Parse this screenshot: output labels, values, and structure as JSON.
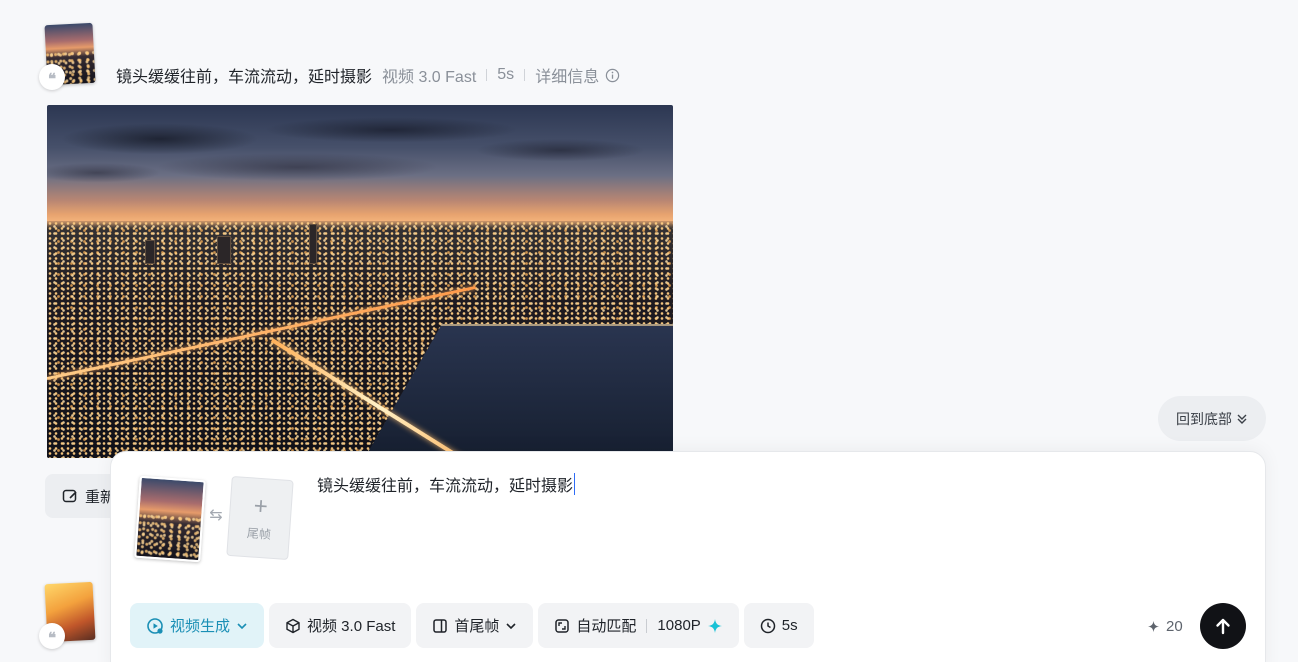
{
  "history": {
    "prompt": "镜头缓缓往前，车流流动，延时摄影",
    "model": "视频 3.0 Fast",
    "duration": "5s",
    "details_label": "详细信息",
    "quote_glyph": "❝"
  },
  "regenerate": {
    "label": "重新"
  },
  "back_to_bottom": {
    "label": "回到底部"
  },
  "composer": {
    "prompt_value": "镜头缓缓往前，车流流动，延时摄影",
    "last_frame_label": "尾帧",
    "toolbar": {
      "mode_label": "视频生成",
      "model_label": "视频 3.0 Fast",
      "frames_label": "首尾帧",
      "ratio_label": "自动匹配",
      "resolution_label": "1080P",
      "duration_label": "5s"
    },
    "credits": "20",
    "accent_color": "#1a8fb5",
    "icons": [
      "quote-icon",
      "info-icon",
      "edit-icon",
      "chevron-double-down-icon",
      "swap-icon",
      "plus-icon",
      "video-gen-icon",
      "cube-icon",
      "frames-icon",
      "aspect-icon",
      "sparkle-icon",
      "clock-icon",
      "arrow-up-icon"
    ]
  }
}
